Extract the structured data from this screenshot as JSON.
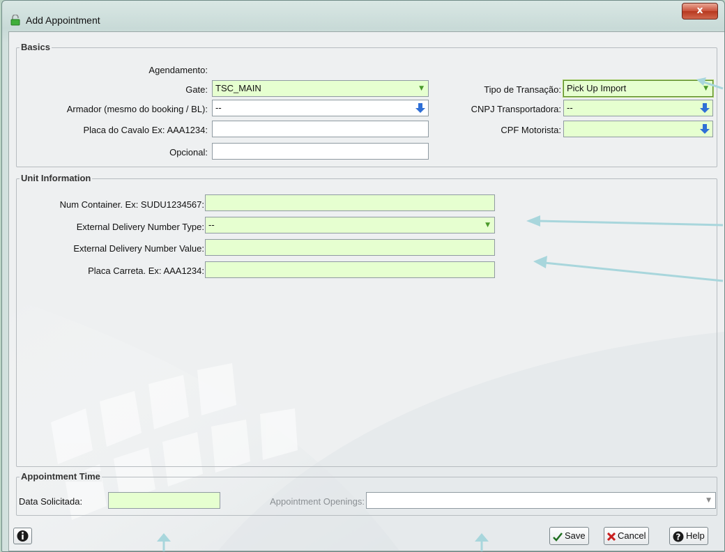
{
  "window": {
    "title": "Add Appointment",
    "close_label": "x"
  },
  "basics": {
    "legend": "Basics",
    "agendamento_label": "Agendamento:",
    "gate_label": "Gate:",
    "gate_value": "TSC_MAIN",
    "armador_label": "Armador (mesmo do booking / BL):",
    "armador_value": "--",
    "placa_cavalo_label": "Placa do Cavalo Ex: AAA1234:",
    "placa_cavalo_value": "",
    "opcional_label": "Opcional:",
    "opcional_value": "",
    "tipo_transacao_label": "Tipo de Transação:",
    "tipo_transacao_value": "Pick Up Import",
    "cnpj_label": "CNPJ Transportadora:",
    "cnpj_value": "--",
    "cpf_label": "CPF Motorista:",
    "cpf_value": ""
  },
  "unit_info": {
    "legend": "Unit Information",
    "container_label": "Num Container. Ex: SUDU1234567:",
    "container_value": "",
    "ext_type_label": "External Delivery Number Type:",
    "ext_type_value": "--",
    "ext_value_label": "External Delivery Number Value:",
    "ext_value_value": "",
    "placa_carreta_label": "Placa Carreta. Ex: AAA1234:",
    "placa_carreta_value": ""
  },
  "appointment_time": {
    "legend": "Appointment Time",
    "data_label": "Data Solicitada:",
    "data_value": "",
    "openings_label": "Appointment Openings:",
    "openings_value": ""
  },
  "footer": {
    "save_label": "Save",
    "cancel_label": "Cancel",
    "help_label": "Help"
  },
  "colors": {
    "required_field": "#e6ffd0",
    "arrow": "#a8d6dc"
  },
  "icons": [
    "padlock-icon",
    "close-icon",
    "lookup-arrow-icon",
    "dropdown-caret-icon",
    "info-icon",
    "check-icon",
    "cross-icon",
    "help-icon"
  ]
}
